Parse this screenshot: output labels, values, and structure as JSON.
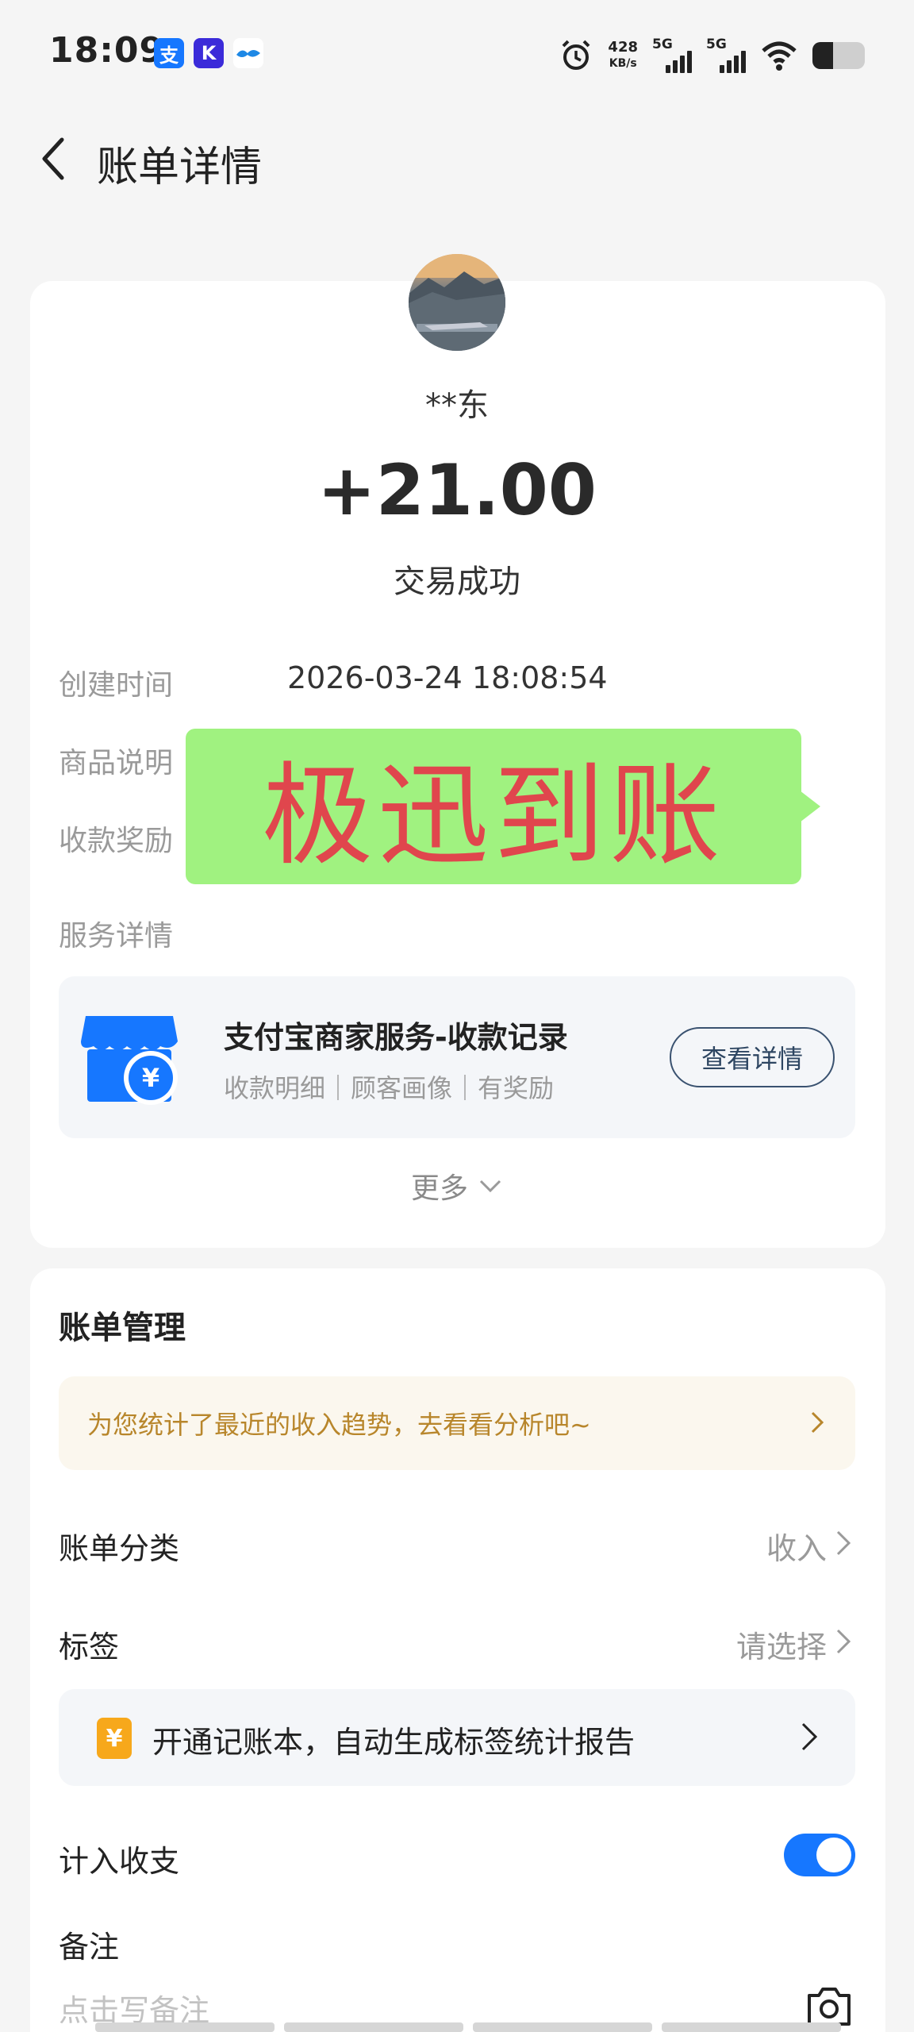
{
  "status_bar": {
    "time": "18:09",
    "apps": [
      {
        "name": "alipay-icon",
        "glyph": "支",
        "color": "#1677ff"
      },
      {
        "name": "app-k-icon",
        "glyph": "K",
        "color": "#3b2bd9"
      },
      {
        "name": "app-bird-icon",
        "glyph": "~",
        "color": "#1e88e5"
      }
    ],
    "speed_value": "428",
    "speed_unit": "KB/s",
    "network_1": "5G",
    "network_2": "5G"
  },
  "header": {
    "title": "账单详情"
  },
  "transaction": {
    "payer": "**东",
    "amount": "+21.00",
    "status": "交易成功",
    "rows": [
      {
        "label": "创建时间",
        "value": "2026-03-24 18:08:54"
      },
      {
        "label": "商品说明",
        "value": ""
      },
      {
        "label": "收款奖励",
        "value": ""
      },
      {
        "label": "服务详情",
        "value": ""
      }
    ]
  },
  "overlay": {
    "text": "极迅到账",
    "bg_color": "#a0f280",
    "text_color": "#e0464d"
  },
  "service": {
    "title": "支付宝商家服务-收款记录",
    "subtitle": "收款明细｜顾客画像｜有奖励",
    "button": "查看详情",
    "icon": "store-icon"
  },
  "more": {
    "label": "更多"
  },
  "bill_management": {
    "title": "账单管理",
    "trend_banner": "为您统计了最近的收入趋势，去看看分析吧~",
    "category_label": "账单分类",
    "category_value": "收入",
    "tag_label": "标签",
    "tag_value": "请选择",
    "ledger_icon_glyph": "¥",
    "ledger_banner": "开通记账本，自动生成标签统计报告",
    "include_label": "计入收支",
    "include_on": true,
    "note_label": "备注",
    "note_placeholder": "点击写备注"
  },
  "colors": {
    "accent": "#1677ff",
    "trend_text": "#b8862b"
  }
}
